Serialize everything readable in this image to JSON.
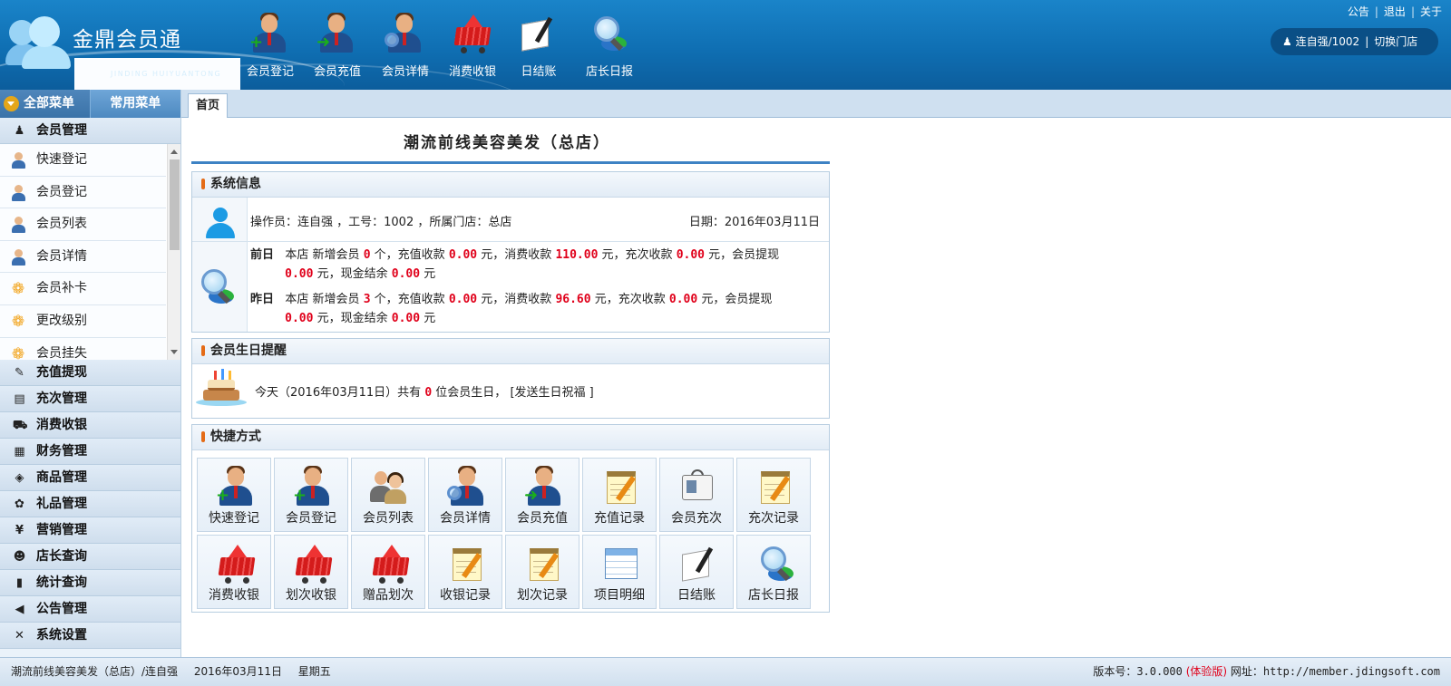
{
  "app": {
    "name": "金鼎会员通",
    "name_en": "JINDING HUIYUANTONG"
  },
  "toolbar": [
    {
      "label": "会员登记",
      "icon": "member-register-icon"
    },
    {
      "label": "会员充值",
      "icon": "member-recharge-icon"
    },
    {
      "label": "会员详情",
      "icon": "member-detail-icon"
    },
    {
      "label": "消费收银",
      "icon": "shopping-cart-icon"
    },
    {
      "label": "日结账",
      "icon": "daily-settlement-icon"
    },
    {
      "label": "店长日报",
      "icon": "manager-report-icon"
    }
  ],
  "top_links": {
    "notice": "公告",
    "logout": "退出",
    "about": "关于"
  },
  "user": {
    "name": "连自强/1002",
    "switch_store": "切换门店"
  },
  "sidebar": {
    "tab_all": "全部菜单",
    "tab_common": "常用菜单",
    "expanded_group": "会员管理",
    "sub_items": [
      {
        "label": "快速登记",
        "icon": "person-icon"
      },
      {
        "label": "会员登记",
        "icon": "person-icon"
      },
      {
        "label": "会员列表",
        "icon": "people-icon"
      },
      {
        "label": "会员详情",
        "icon": "person-icon"
      },
      {
        "label": "会员补卡",
        "icon": "flower-icon"
      },
      {
        "label": "更改级别",
        "icon": "flower-icon"
      },
      {
        "label": "会员挂失",
        "icon": "flower-icon"
      }
    ],
    "groups": [
      {
        "label": "充值提现",
        "icon": "✎"
      },
      {
        "label": "充次管理",
        "icon": "▤"
      },
      {
        "label": "消费收银",
        "icon": "⛟"
      },
      {
        "label": "财务管理",
        "icon": "▦"
      },
      {
        "label": "商品管理",
        "icon": "◈"
      },
      {
        "label": "礼品管理",
        "icon": "✿"
      },
      {
        "label": "营销管理",
        "icon": "¥"
      },
      {
        "label": "店长查询",
        "icon": "☻"
      },
      {
        "label": "统计查询",
        "icon": "▮"
      },
      {
        "label": "公告管理",
        "icon": "◀"
      },
      {
        "label": "系统设置",
        "icon": "✕"
      }
    ]
  },
  "main": {
    "tab": "首页",
    "shop_title": "潮流前线美容美发（总店）",
    "system_info": {
      "title": "系统信息",
      "operator_line": "操作员：连自强 ，工号：1002 ，所属门店：总店",
      "date_line": "日期：2016年03月11日",
      "day_before": {
        "label": "前日",
        "prefix": "本店 新增会员",
        "new_members": "0",
        "t1": "个，充值收款",
        "recharge": "0.00",
        "t2": "元，消费收款",
        "consume": "110.00",
        "t3": "元，充次收款",
        "times": "0.00",
        "t4": "元，会员提现",
        "withdraw": "0.00",
        "t5": "元，现金结余",
        "cash": "0.00",
        "t6": "元"
      },
      "yesterday": {
        "label": "昨日",
        "prefix": "本店 新增会员",
        "new_members": "3",
        "t1": "个，充值收款",
        "recharge": "0.00",
        "t2": "元，消费收款",
        "consume": "96.60",
        "t3": "元，充次收款",
        "times": "0.00",
        "t4": "元，会员提现",
        "withdraw": "0.00",
        "t5": "元，现金结余",
        "cash": "0.00",
        "t6": "元"
      }
    },
    "birthday": {
      "title": "会员生日提醒",
      "text_before": "今天（2016年03月11日）共有",
      "count": "0",
      "text_after": "位会员生日，",
      "link": "[发送生日祝福 ]"
    },
    "shortcuts": {
      "title": "快捷方式",
      "items": [
        {
          "label": "快速登记",
          "icon": "member-add-icon"
        },
        {
          "label": "会员登记",
          "icon": "member-add-icon"
        },
        {
          "label": "会员列表",
          "icon": "member-list-icon"
        },
        {
          "label": "会员详情",
          "icon": "member-detail-icon"
        },
        {
          "label": "会员充值",
          "icon": "member-recharge-icon"
        },
        {
          "label": "充值记录",
          "icon": "notepad-icon"
        },
        {
          "label": "会员充次",
          "icon": "member-card-icon"
        },
        {
          "label": "充次记录",
          "icon": "notepad-icon"
        },
        {
          "label": "消费收银",
          "icon": "shopping-cart-icon"
        },
        {
          "label": "划次收银",
          "icon": "shopping-cart-icon"
        },
        {
          "label": "赠品划次",
          "icon": "shopping-cart-icon"
        },
        {
          "label": "收银记录",
          "icon": "notepad-icon"
        },
        {
          "label": "划次记录",
          "icon": "notepad-icon"
        },
        {
          "label": "项目明细",
          "icon": "spreadsheet-icon"
        },
        {
          "label": "日结账",
          "icon": "ledger-pen-icon"
        },
        {
          "label": "店长日报",
          "icon": "magnifier-chart-icon"
        }
      ]
    }
  },
  "footer": {
    "store_user": "潮流前线美容美发（总店）/连自强",
    "date": "2016年03月11日",
    "weekday": "星期五",
    "version_label": "版本号：3.0.000",
    "trial": "(体验版)",
    "website": "网址：http://member.jdingsoft.com"
  }
}
